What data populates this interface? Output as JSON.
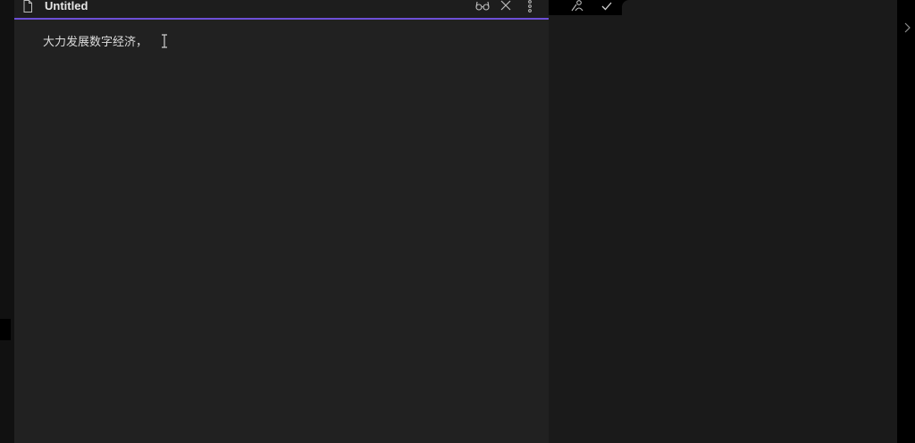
{
  "pane": {
    "title": "Untitled",
    "icons": {
      "file": "file-icon",
      "reading": "glasses-icon",
      "close": "close-icon",
      "more": "more-options-icon"
    }
  },
  "editor": {
    "text": "大力发展数字经济，"
  },
  "toolbar": {
    "icons": [
      "people-icon",
      "check-icon"
    ]
  },
  "right_panel": {
    "expand_icon": "chevron-right-icon"
  },
  "colors": {
    "accent": "#6d4fd6",
    "pane_bg": "#212121",
    "side_bg": "#1a1a1a",
    "text": "#dcdcdc"
  }
}
